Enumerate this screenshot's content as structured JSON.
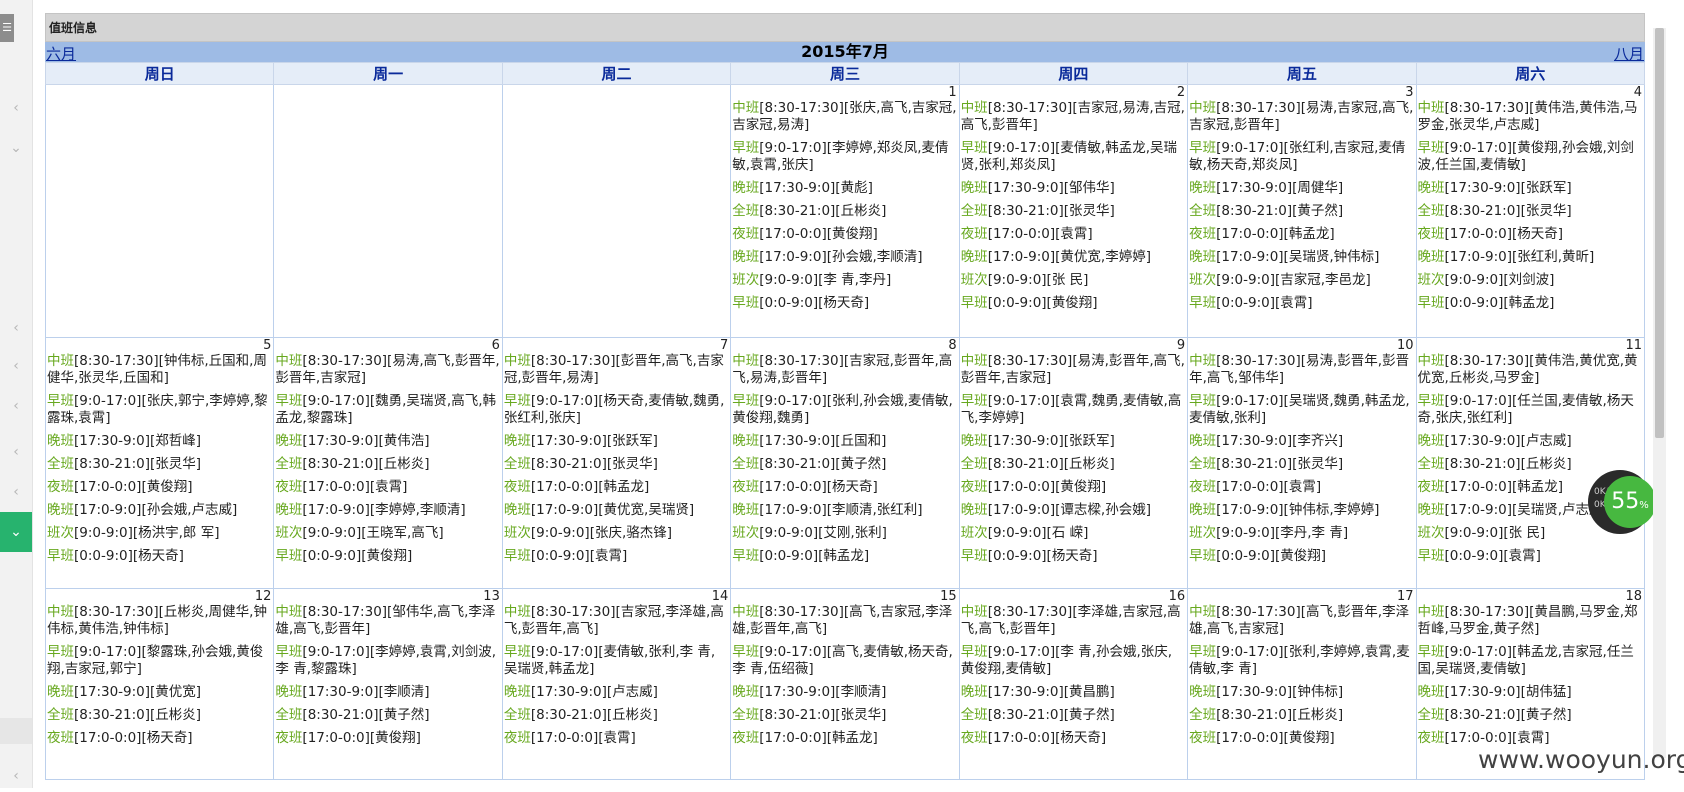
{
  "panel": {
    "title": "值班信息"
  },
  "calendar": {
    "title": "2015年7月",
    "prev_label": "六月",
    "next_label": "八月",
    "weekdays": [
      "周日",
      "周一",
      "周二",
      "周三",
      "周四",
      "周五",
      "周六"
    ],
    "weeks": [
      [
        {
          "day": "",
          "entries": []
        },
        {
          "day": "",
          "entries": []
        },
        {
          "day": "",
          "entries": []
        },
        {
          "day": "1",
          "entries": [
            {
              "kind": "中班",
              "text": "[8:30-17:30][张庆,高飞,吉家冠,吉家冠,易涛]"
            },
            {
              "kind": "早班",
              "text": "[9:0-17:0][李婷婷,郑炎凤,麦倩敏,袁霄,张庆]"
            },
            {
              "kind": "晚班",
              "text": "[17:30-9:0][黄彪]"
            },
            {
              "kind": "全班",
              "text": "[8:30-21:0][丘彬炎]"
            },
            {
              "kind": "夜班",
              "text": "[17:0-0:0][黄俊翔]"
            },
            {
              "kind": "晚班",
              "text": "[17:0-9:0][孙会娥,李顺清]"
            },
            {
              "kind": "班次",
              "text": "[9:0-9:0][李 青,李丹]"
            },
            {
              "kind": "早班",
              "text": "[0:0-9:0][杨天奇]"
            }
          ]
        },
        {
          "day": "2",
          "entries": [
            {
              "kind": "中班",
              "text": "[8:30-17:30][吉家冠,易涛,吉冠,高飞,彭晋年]"
            },
            {
              "kind": "早班",
              "text": "[9:0-17:0][麦倩敏,韩孟龙,吴瑞贤,张利,郑炎凤]"
            },
            {
              "kind": "晚班",
              "text": "[17:30-9:0][邹伟华]"
            },
            {
              "kind": "全班",
              "text": "[8:30-21:0][张灵华]"
            },
            {
              "kind": "夜班",
              "text": "[17:0-0:0][袁霄]"
            },
            {
              "kind": "晚班",
              "text": "[17:0-9:0][黄优宽,李婷婷]"
            },
            {
              "kind": "班次",
              "text": "[9:0-9:0][张 民]"
            },
            {
              "kind": "早班",
              "text": "[0:0-9:0][黄俊翔]"
            }
          ]
        },
        {
          "day": "3",
          "entries": [
            {
              "kind": "中班",
              "text": "[8:30-17:30][易涛,吉家冠,高飞,吉家冠,彭晋年]"
            },
            {
              "kind": "早班",
              "text": "[9:0-17:0][张红利,吉家冠,麦倩敏,杨天奇,郑炎凤]"
            },
            {
              "kind": "晚班",
              "text": "[17:30-9:0][周健华]"
            },
            {
              "kind": "全班",
              "text": "[8:30-21:0][黄子然]"
            },
            {
              "kind": "夜班",
              "text": "[17:0-0:0][韩孟龙]"
            },
            {
              "kind": "晚班",
              "text": "[17:0-9:0][吴瑞贤,钟伟标]"
            },
            {
              "kind": "班次",
              "text": "[9:0-9:0][吉家冠,李邑龙]"
            },
            {
              "kind": "早班",
              "text": "[0:0-9:0][袁霄]"
            }
          ]
        },
        {
          "day": "4",
          "entries": [
            {
              "kind": "中班",
              "text": "[8:30-17:30][黄伟浩,黄伟浩,马罗金,张灵华,卢志威]"
            },
            {
              "kind": "早班",
              "text": "[9:0-17:0][黄俊翔,孙会娥,刘剑波,任兰国,麦倩敏]"
            },
            {
              "kind": "晚班",
              "text": "[17:30-9:0][张跃军]"
            },
            {
              "kind": "全班",
              "text": "[8:30-21:0][张灵华]"
            },
            {
              "kind": "夜班",
              "text": "[17:0-0:0][杨天奇]"
            },
            {
              "kind": "晚班",
              "text": "[17:0-9:0][张红利,黄昕]"
            },
            {
              "kind": "班次",
              "text": "[9:0-9:0][刘剑波]"
            },
            {
              "kind": "早班",
              "text": "[0:0-9:0][韩孟龙]"
            }
          ]
        }
      ],
      [
        {
          "day": "5",
          "entries": [
            {
              "kind": "中班",
              "text": "[8:30-17:30][钟伟标,丘国和,周健华,张灵华,丘国和]"
            },
            {
              "kind": "早班",
              "text": "[9:0-17:0][张庆,郭宁,李婷婷,黎露珠,袁霄]"
            },
            {
              "kind": "晚班",
              "text": "[17:30-9:0][郑哲峰]"
            },
            {
              "kind": "全班",
              "text": "[8:30-21:0][张灵华]"
            },
            {
              "kind": "夜班",
              "text": "[17:0-0:0][黄俊翔]"
            },
            {
              "kind": "晚班",
              "text": "[17:0-9:0][孙会娥,卢志威]"
            },
            {
              "kind": "班次",
              "text": "[9:0-9:0][杨洪宇,郎 军]"
            },
            {
              "kind": "早班",
              "text": "[0:0-9:0][杨天奇]"
            }
          ]
        },
        {
          "day": "6",
          "entries": [
            {
              "kind": "中班",
              "text": "[8:30-17:30][易涛,高飞,彭晋年,彭晋年,吉家冠]"
            },
            {
              "kind": "早班",
              "text": "[9:0-17:0][魏勇,吴瑞贤,高飞,韩孟龙,黎露珠]"
            },
            {
              "kind": "晚班",
              "text": "[17:30-9:0][黄伟浩]"
            },
            {
              "kind": "全班",
              "text": "[8:30-21:0][丘彬炎]"
            },
            {
              "kind": "夜班",
              "text": "[17:0-0:0][袁霄]"
            },
            {
              "kind": "晚班",
              "text": "[17:0-9:0][李婷婷,李顺清]"
            },
            {
              "kind": "班次",
              "text": "[9:0-9:0][王晓军,高飞]"
            },
            {
              "kind": "早班",
              "text": "[0:0-9:0][黄俊翔]"
            }
          ]
        },
        {
          "day": "7",
          "entries": [
            {
              "kind": "中班",
              "text": "[8:30-17:30][彭晋年,高飞,吉家冠,彭晋年,易涛]"
            },
            {
              "kind": "早班",
              "text": "[9:0-17:0][杨天奇,麦倩敏,魏勇,张红利,张庆]"
            },
            {
              "kind": "晚班",
              "text": "[17:30-9:0][张跃军]"
            },
            {
              "kind": "全班",
              "text": "[8:30-21:0][张灵华]"
            },
            {
              "kind": "夜班",
              "text": "[17:0-0:0][韩孟龙]"
            },
            {
              "kind": "晚班",
              "text": "[17:0-9:0][黄优宽,吴瑞贤]"
            },
            {
              "kind": "班次",
              "text": "[9:0-9:0][张庆,骆杰锋]"
            },
            {
              "kind": "早班",
              "text": "[0:0-9:0][袁霄]"
            }
          ]
        },
        {
          "day": "8",
          "entries": [
            {
              "kind": "中班",
              "text": "[8:30-17:30][吉家冠,彭晋年,高飞,易涛,彭晋年]"
            },
            {
              "kind": "早班",
              "text": "[9:0-17:0][张利,孙会娥,麦倩敏,黄俊翔,魏勇]"
            },
            {
              "kind": "晚班",
              "text": "[17:30-9:0][丘国和]"
            },
            {
              "kind": "全班",
              "text": "[8:30-21:0][黄子然]"
            },
            {
              "kind": "夜班",
              "text": "[17:0-0:0][杨天奇]"
            },
            {
              "kind": "晚班",
              "text": "[17:0-9:0][李顺清,张红利]"
            },
            {
              "kind": "班次",
              "text": "[9:0-9:0][艾刚,张利]"
            },
            {
              "kind": "早班",
              "text": "[0:0-9:0][韩孟龙]"
            }
          ]
        },
        {
          "day": "9",
          "entries": [
            {
              "kind": "中班",
              "text": "[8:30-17:30][易涛,彭晋年,高飞,彭晋年,吉家冠]"
            },
            {
              "kind": "早班",
              "text": "[9:0-17:0][袁霄,魏勇,麦倩敏,高飞,李婷婷]"
            },
            {
              "kind": "晚班",
              "text": "[17:30-9:0][张跃军]"
            },
            {
              "kind": "全班",
              "text": "[8:30-21:0][丘彬炎]"
            },
            {
              "kind": "夜班",
              "text": "[17:0-0:0][黄俊翔]"
            },
            {
              "kind": "晚班",
              "text": "[17:0-9:0][谭志樑,孙会娥]"
            },
            {
              "kind": "班次",
              "text": "[9:0-9:0][石 嵘]"
            },
            {
              "kind": "早班",
              "text": "[0:0-9:0][杨天奇]"
            }
          ]
        },
        {
          "day": "10",
          "entries": [
            {
              "kind": "中班",
              "text": "[8:30-17:30][易涛,彭晋年,彭晋年,高飞,邹伟华]"
            },
            {
              "kind": "早班",
              "text": "[9:0-17:0][吴瑞贤,魏勇,韩孟龙,麦倩敏,张利]"
            },
            {
              "kind": "晚班",
              "text": "[17:30-9:0][李齐兴]"
            },
            {
              "kind": "全班",
              "text": "[8:30-21:0][张灵华]"
            },
            {
              "kind": "夜班",
              "text": "[17:0-0:0][袁霄]"
            },
            {
              "kind": "晚班",
              "text": "[17:0-9:0][钟伟标,李婷婷]"
            },
            {
              "kind": "班次",
              "text": "[9:0-9:0][李丹,李 青]"
            },
            {
              "kind": "早班",
              "text": "[0:0-9:0][黄俊翔]"
            }
          ]
        },
        {
          "day": "11",
          "entries": [
            {
              "kind": "中班",
              "text": "[8:30-17:30][黄伟浩,黄优宽,黄优宽,丘彬炎,马罗金]"
            },
            {
              "kind": "早班",
              "text": "[9:0-17:0][任兰国,麦倩敏,杨天奇,张庆,张红利]"
            },
            {
              "kind": "晚班",
              "text": "[17:30-9:0][卢志威]"
            },
            {
              "kind": "全班",
              "text": "[8:30-21:0][丘彬炎]"
            },
            {
              "kind": "夜班",
              "text": "[17:0-0:0][韩孟龙]"
            },
            {
              "kind": "晚班",
              "text": "[17:0-9:0][吴瑞贤,卢志威]"
            },
            {
              "kind": "班次",
              "text": "[9:0-9:0][张 民]"
            },
            {
              "kind": "早班",
              "text": "[0:0-9:0][袁霄]"
            }
          ]
        }
      ],
      [
        {
          "day": "12",
          "entries": [
            {
              "kind": "中班",
              "text": "[8:30-17:30][丘彬炎,周健华,钟伟标,黄伟浩,钟伟标]"
            },
            {
              "kind": "早班",
              "text": "[9:0-17:0][黎露珠,孙会娥,黄俊翔,吉家冠,郭宁]"
            },
            {
              "kind": "晚班",
              "text": "[17:30-9:0][黄优宽]"
            },
            {
              "kind": "全班",
              "text": "[8:30-21:0][丘彬炎]"
            },
            {
              "kind": "夜班",
              "text": "[17:0-0:0][杨天奇]"
            }
          ]
        },
        {
          "day": "13",
          "entries": [
            {
              "kind": "中班",
              "text": "[8:30-17:30][邹伟华,高飞,李泽雄,高飞,彭晋年]"
            },
            {
              "kind": "早班",
              "text": "[9:0-17:0][李婷婷,袁霄,刘剑波,李 青,黎露珠]"
            },
            {
              "kind": "晚班",
              "text": "[17:30-9:0][李顺清]"
            },
            {
              "kind": "全班",
              "text": "[8:30-21:0][黄子然]"
            },
            {
              "kind": "夜班",
              "text": "[17:0-0:0][黄俊翔]"
            }
          ]
        },
        {
          "day": "14",
          "entries": [
            {
              "kind": "中班",
              "text": "[8:30-17:30][吉家冠,李泽雄,高飞,彭晋年,高飞]"
            },
            {
              "kind": "早班",
              "text": "[9:0-17:0][麦倩敏,张利,李 青,吴瑞贤,韩孟龙]"
            },
            {
              "kind": "晚班",
              "text": "[17:30-9:0][卢志威]"
            },
            {
              "kind": "全班",
              "text": "[8:30-21:0][丘彬炎]"
            },
            {
              "kind": "夜班",
              "text": "[17:0-0:0][袁霄]"
            }
          ]
        },
        {
          "day": "15",
          "entries": [
            {
              "kind": "中班",
              "text": "[8:30-17:30][高飞,吉家冠,李泽雄,彭晋年,高飞]"
            },
            {
              "kind": "早班",
              "text": "[9:0-17:0][高飞,麦倩敏,杨天奇,李 青,伍绍薇]"
            },
            {
              "kind": "晚班",
              "text": "[17:30-9:0][李顺清]"
            },
            {
              "kind": "全班",
              "text": "[8:30-21:0][张灵华]"
            },
            {
              "kind": "夜班",
              "text": "[17:0-0:0][韩孟龙]"
            }
          ]
        },
        {
          "day": "16",
          "entries": [
            {
              "kind": "中班",
              "text": "[8:30-17:30][李泽雄,吉家冠,高飞,高飞,彭晋年]"
            },
            {
              "kind": "早班",
              "text": "[9:0-17:0][李 青,孙会娥,张庆,黄俊翔,麦倩敏]"
            },
            {
              "kind": "晚班",
              "text": "[17:30-9:0][黄昌鹏]"
            },
            {
              "kind": "全班",
              "text": "[8:30-21:0][黄子然]"
            },
            {
              "kind": "夜班",
              "text": "[17:0-0:0][杨天奇]"
            }
          ]
        },
        {
          "day": "17",
          "entries": [
            {
              "kind": "中班",
              "text": "[8:30-17:30][高飞,彭晋年,李泽雄,高飞,吉家冠]"
            },
            {
              "kind": "早班",
              "text": "[9:0-17:0][张利,李婷婷,袁霄,麦倩敏,李 青]"
            },
            {
              "kind": "晚班",
              "text": "[17:30-9:0][钟伟标]"
            },
            {
              "kind": "全班",
              "text": "[8:30-21:0][丘彬炎]"
            },
            {
              "kind": "夜班",
              "text": "[17:0-0:0][黄俊翔]"
            }
          ]
        },
        {
          "day": "18",
          "entries": [
            {
              "kind": "中班",
              "text": "[8:30-17:30][黄昌鹏,马罗金,郑哲峰,马罗金,黄子然]"
            },
            {
              "kind": "早班",
              "text": "[9:0-17:0][韩孟龙,吉家冠,任兰国,吴瑞贤,麦倩敏]"
            },
            {
              "kind": "晚班",
              "text": "[17:30-9:0][胡伟猛]"
            },
            {
              "kind": "全班",
              "text": "[8:30-21:0][黄子然]"
            },
            {
              "kind": "夜班",
              "text": "[17:0-0:0][袁霄]"
            }
          ]
        }
      ]
    ]
  },
  "speed_widget": {
    "percent": "55",
    "unit": "%",
    "up": "0K/s",
    "down": "0K/s"
  },
  "watermark": "www.wooyun.org",
  "icons": {
    "sidebar_chevron": "chevron-left-icon",
    "sidebar_down": "chevron-down-icon"
  }
}
